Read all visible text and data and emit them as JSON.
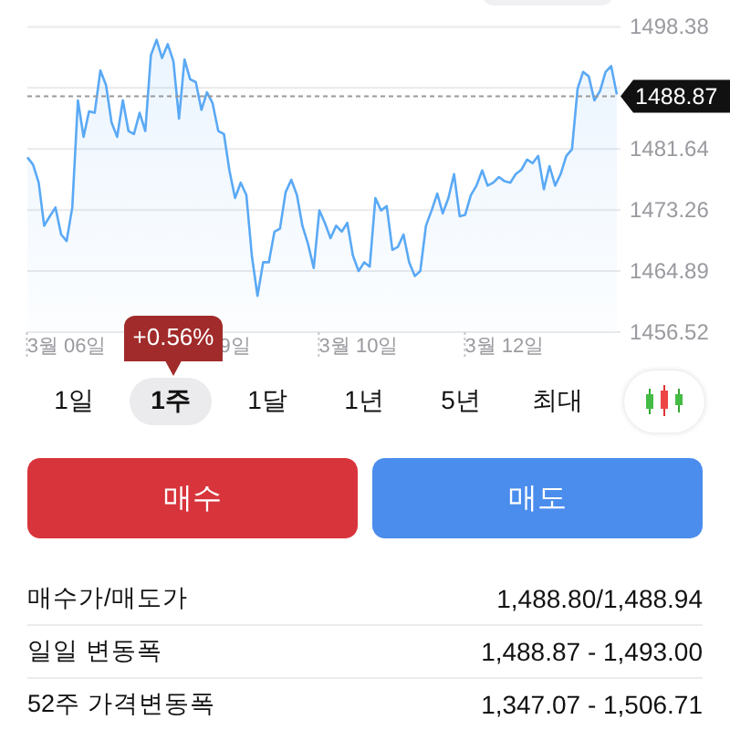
{
  "chart": {
    "chart_data": {
      "type": "area",
      "grid": true,
      "categories": [
        null,
        null,
        null,
        null,
        null,
        null,
        null,
        "3월 06일",
        null,
        null,
        null,
        null,
        null,
        null,
        null,
        null,
        null,
        null,
        null,
        null,
        null,
        null,
        null,
        null,
        null,
        null,
        null,
        null,
        null,
        null,
        null,
        null,
        null,
        null,
        null,
        null,
        null,
        "9일",
        null,
        null,
        null,
        null,
        null,
        null,
        null,
        null,
        null,
        null,
        null,
        null,
        null,
        null,
        null,
        null,
        null,
        null,
        null,
        null,
        null,
        "3월 10일",
        null,
        null,
        null,
        null,
        null,
        null,
        null,
        null,
        null,
        null,
        null,
        null,
        null,
        null,
        null,
        null,
        null,
        null,
        null,
        null,
        null,
        null,
        null,
        null,
        null,
        "3월 12일",
        null,
        null,
        null,
        null,
        null,
        null,
        null,
        null,
        null,
        null,
        null,
        null,
        null,
        null,
        null,
        null,
        null,
        null,
        null,
        null
      ],
      "series": [
        {
          "color": "#5aa9f5",
          "values": [
            1480.5,
            1479.5,
            1477,
            1471.1,
            1472.4,
            1473.6,
            1469.9,
            1469,
            1473.6,
            1488.3,
            1483.3,
            1486.8,
            1486.6,
            1492.4,
            1490.4,
            1485.3,
            1483.3,
            1488.3,
            1484.1,
            1483.7,
            1486.6,
            1484.1,
            1494.5,
            1496.6,
            1494.1,
            1496,
            1493.7,
            1485.8,
            1493.9,
            1491.2,
            1490.8,
            1487,
            1489.4,
            1487.9,
            1484.1,
            1483.7,
            1478.7,
            1474.9,
            1477,
            1475.3,
            1467,
            1461.5,
            1466.1,
            1466.1,
            1470.3,
            1470.7,
            1475.7,
            1477.4,
            1475.3,
            1471.1,
            1468.6,
            1465.3,
            1473.2,
            1471.5,
            1469.4,
            1471.1,
            1470.3,
            1471.5,
            1467,
            1464.9,
            1466.1,
            1465.5,
            1474.9,
            1473.2,
            1473.8,
            1467.8,
            1468.2,
            1469.9,
            1466.1,
            1464.2,
            1464.9,
            1471.1,
            1473.2,
            1475.5,
            1472.8,
            1474.9,
            1478.2,
            1472.4,
            1472.6,
            1475.3,
            1476.6,
            1478.7,
            1476.6,
            1477,
            1477.8,
            1477.2,
            1477,
            1478.2,
            1478.8,
            1480.2,
            1479.7,
            1480.7,
            1476.1,
            1479.3,
            1476.6,
            1478.2,
            1480.7,
            1481.6,
            1489.9,
            1492.2,
            1491.6,
            1488.3,
            1489.6,
            1492.2,
            1493,
            1489.1
          ]
        }
      ],
      "ylim": [
        1456.52,
        1498.38
      ],
      "yticks": [
        1498.38,
        1481.64,
        1473.26,
        1464.89,
        1456.52
      ],
      "ref_lines": [
        {
          "axis": "y",
          "value": 1488.87,
          "label": "1488.87"
        }
      ]
    }
  },
  "tooltip": {
    "text": "+0.56%"
  },
  "ranges": [
    {
      "label": "1일",
      "selected": false
    },
    {
      "label": "1주",
      "selected": true
    },
    {
      "label": "1달",
      "selected": false
    },
    {
      "label": "1년",
      "selected": false
    },
    {
      "label": "5년",
      "selected": false
    },
    {
      "label": "최대",
      "selected": false
    }
  ],
  "buttons": [
    {
      "label": "매수",
      "kind": "buy"
    },
    {
      "label": "매도",
      "kind": "sell"
    }
  ],
  "info": [
    {
      "label": "매수가/매도가",
      "value": "1,488.80/1,488.94"
    },
    {
      "label": "일일 변동폭",
      "value": "1,488.87 - 1,493.00"
    },
    {
      "label": "52주 가격변동폭",
      "value": "1,347.07 - 1,506.71"
    }
  ]
}
